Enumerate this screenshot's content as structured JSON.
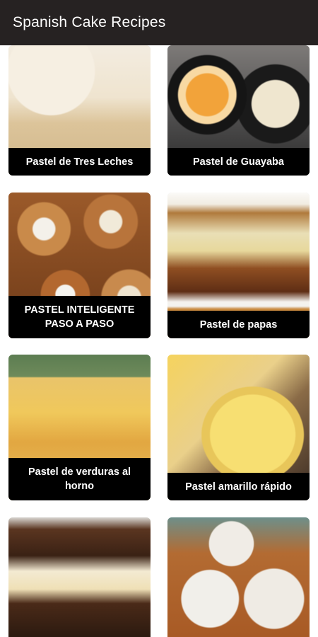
{
  "app_bar": {
    "title": "Spanish Cake Recipes"
  },
  "recipes": [
    {
      "label": "Pastel de Tres Leches",
      "photo": "tres-leches-photo"
    },
    {
      "label": "Pastel de Guayaba",
      "photo": "guayaba-photo"
    },
    {
      "label": "PASTEL INTELIGENTE PASO A PASO",
      "photo": "inteligente-photo"
    },
    {
      "label": "Pastel de papas",
      "photo": "papas-photo"
    },
    {
      "label": "Pastel de verduras al horno",
      "photo": "verduras-photo"
    },
    {
      "label": "Pastel amarillo rápido",
      "photo": "amarillo-photo"
    },
    {
      "label": "",
      "photo": "chocolate-cake-photo"
    },
    {
      "label": "",
      "photo": "coconut-cake-photo"
    }
  ]
}
